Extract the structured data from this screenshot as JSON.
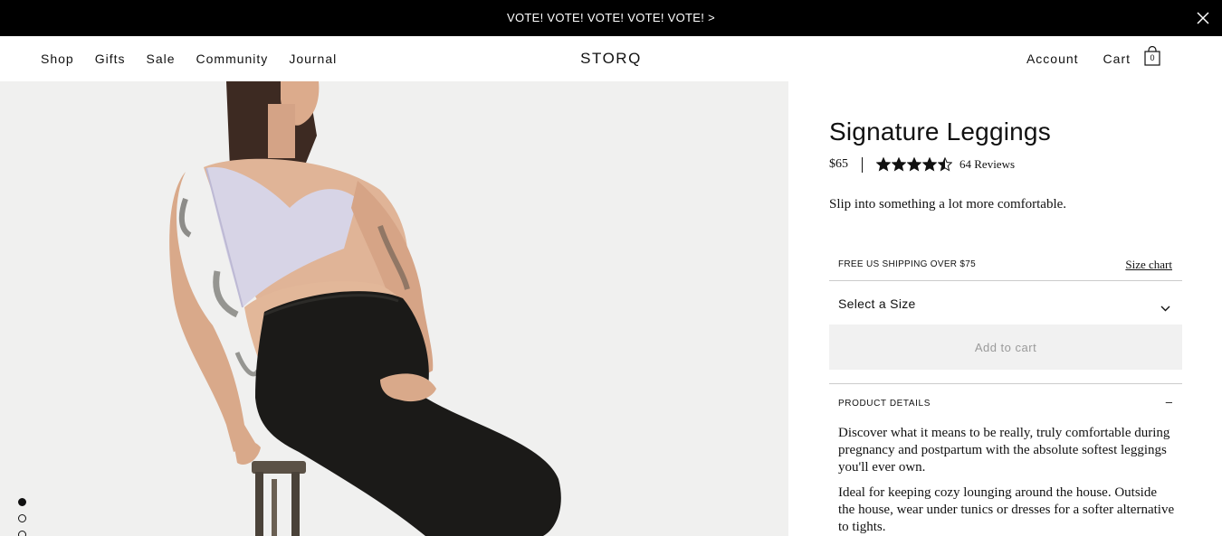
{
  "announcement": {
    "text": "VOTE! VOTE! VOTE! VOTE! VOTE! >",
    "close_icon": "close-icon"
  },
  "header": {
    "nav": [
      "Shop",
      "Gifts",
      "Sale",
      "Community",
      "Journal"
    ],
    "logo": "STORQ",
    "account_label": "Account",
    "cart_label": "Cart",
    "cart_count": "0",
    "cart_icon": "shopping-bag-icon"
  },
  "gallery": {
    "image_description": "pregnant-woman-seated-on-stool-in-black-leggings",
    "slides_visible": 3,
    "active_slide": 1
  },
  "product": {
    "title": "Signature Leggings",
    "price": "$65",
    "rating": 4.5,
    "rating_max": 5,
    "reviews": "64 Reviews",
    "tagline": "Slip into something a lot more comfortable.",
    "shipping_note": "FREE US SHIPPING OVER $75",
    "size_chart_label": "Size chart",
    "size_select_label": "Select a Size",
    "add_to_cart_label": "Add to cart",
    "details_label": "PRODUCT DETAILS",
    "details_toggle": "–",
    "details_paragraphs": [
      "Discover what it means to be really, truly comfortable during pregnancy and postpartum with the absolute softest leggings you'll ever own.",
      "Ideal for keeping cozy lounging around the house. Outside the house, wear under tunics or dresses for a softer alternative to tights."
    ]
  },
  "colors": {
    "announcement_bg": "#000000",
    "button_bg": "#f1f1f1",
    "button_text": "#9a9a9a"
  }
}
